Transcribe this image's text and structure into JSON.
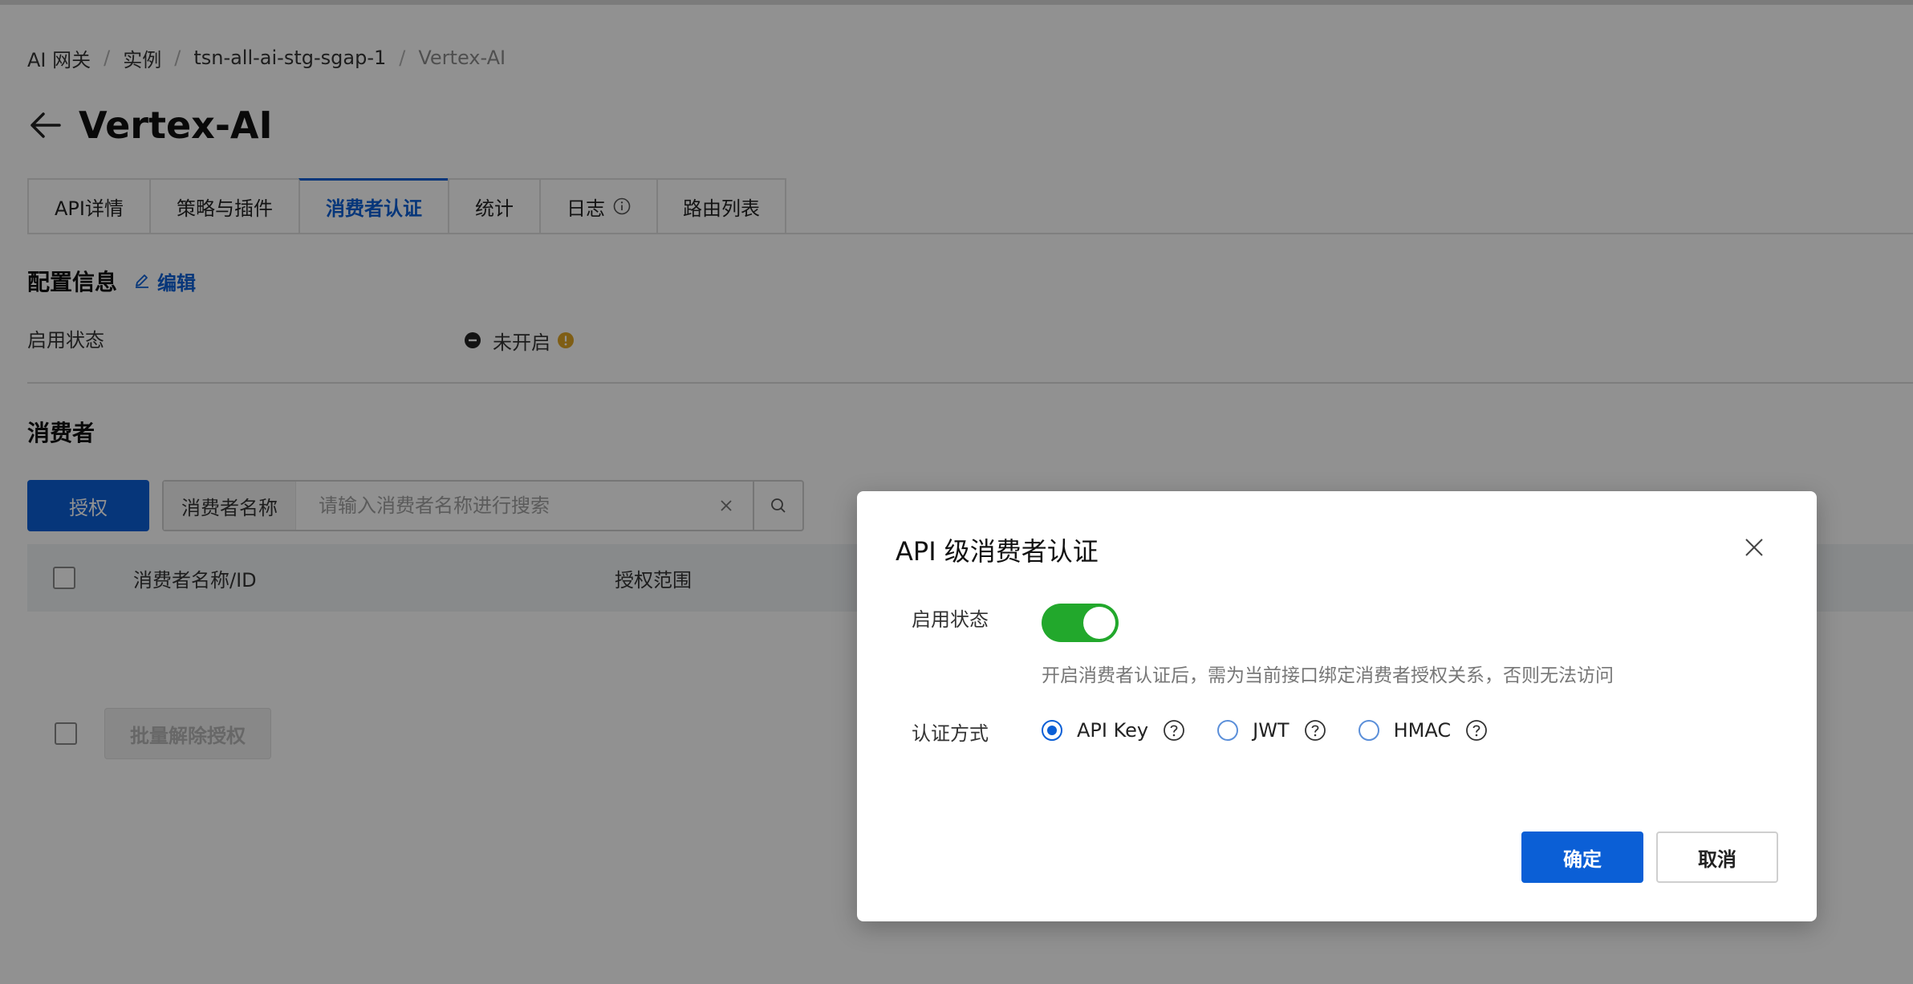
{
  "breadcrumb": {
    "items": [
      "AI 网关",
      "实例",
      "tsn-all-ai-stg-sgap-1",
      "Vertex-AI"
    ],
    "separator": "/"
  },
  "page": {
    "title": "Vertex-AI"
  },
  "tabs": [
    {
      "label": "API详情"
    },
    {
      "label": "策略与插件"
    },
    {
      "label": "消费者认证",
      "active": true
    },
    {
      "label": "统计"
    },
    {
      "label": "日志",
      "icon": "info-icon"
    },
    {
      "label": "路由列表"
    }
  ],
  "config": {
    "title": "配置信息",
    "edit_label": "编辑",
    "status_label": "启用状态",
    "status_value": "未开启"
  },
  "consumers": {
    "title": "消费者",
    "auth_button": "授权",
    "search_prefix": "消费者名称",
    "search_placeholder": "请输入消费者名称进行搜索",
    "columns": [
      "消费者名称/ID",
      "授权范围"
    ],
    "bulk_button": "批量解除授权"
  },
  "modal": {
    "title": "API 级消费者认证",
    "status_label": "启用状态",
    "status_enabled": true,
    "hint": "开启消费者认证后，需为当前接口绑定消费者授权关系，否则无法访问",
    "method_label": "认证方式",
    "methods": [
      {
        "label": "API Key",
        "checked": true
      },
      {
        "label": "JWT",
        "checked": false
      },
      {
        "label": "HMAC",
        "checked": false
      }
    ],
    "ok_button": "确定",
    "cancel_button": "取消"
  },
  "colors": {
    "primary": "#0b5fd6",
    "switch_on": "#22a82c",
    "warning": "#e0a526"
  }
}
